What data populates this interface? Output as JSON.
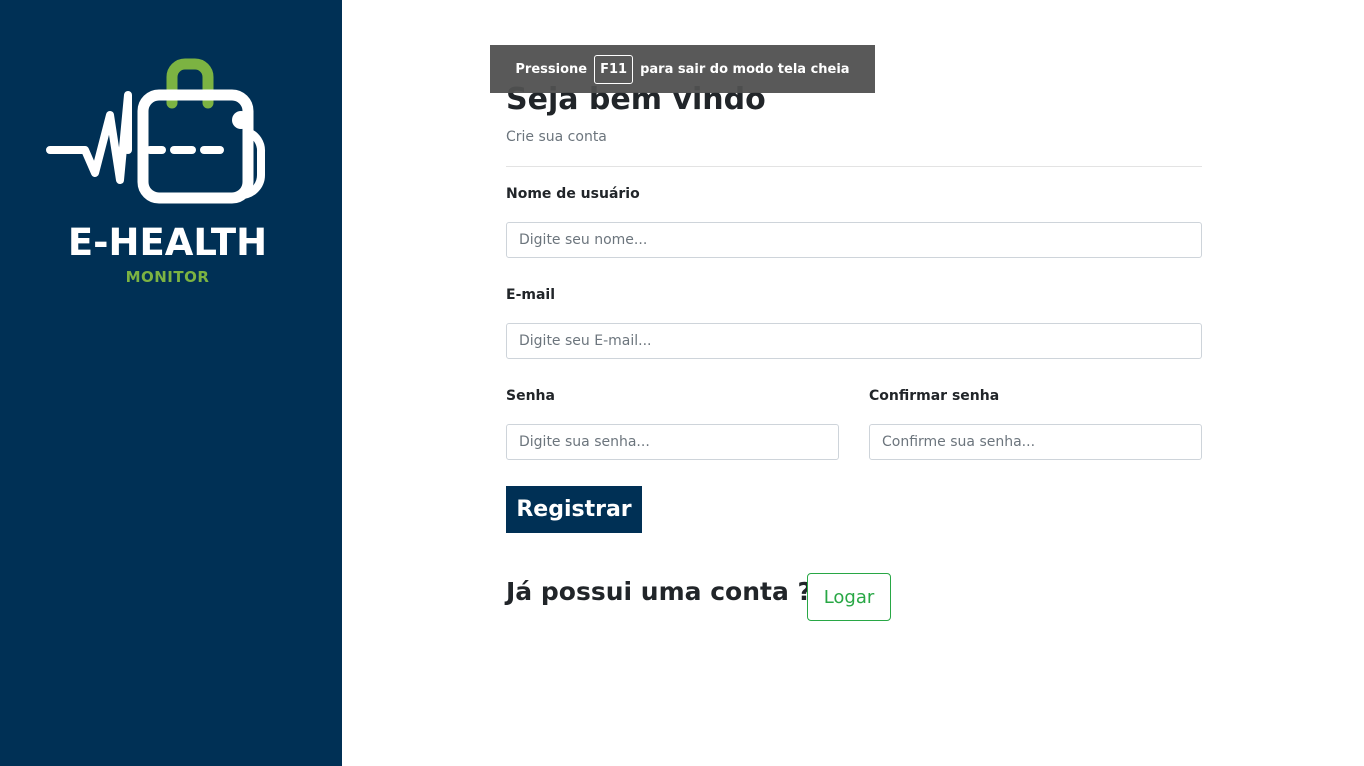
{
  "brand": {
    "name": "E-HEALTH",
    "subname": "MONITOR",
    "colors": {
      "sidebar": "#003055",
      "accent_green": "#7cb342",
      "primary_button": "#003055",
      "outline_success": "#28a745"
    }
  },
  "fullscreen_notice": {
    "before": "Pressione",
    "key": "F11",
    "after": "para sair do modo tela cheia"
  },
  "form": {
    "title": "Seja bem vindo",
    "subtitle": "Crie sua conta",
    "username": {
      "label": "Nome de usuário",
      "placeholder": "Digite seu nome...",
      "value": ""
    },
    "email": {
      "label": "E-mail",
      "placeholder": "Digite seu E-mail...",
      "value": ""
    },
    "password": {
      "label": "Senha",
      "placeholder": "Digite sua senha...",
      "value": ""
    },
    "confirm_password": {
      "label": "Confirmar senha",
      "placeholder": "Confirme sua senha...",
      "value": ""
    },
    "register_label": "Registrar"
  },
  "login_prompt": {
    "text": "Já possui uma conta ?",
    "button_label": "Logar"
  }
}
